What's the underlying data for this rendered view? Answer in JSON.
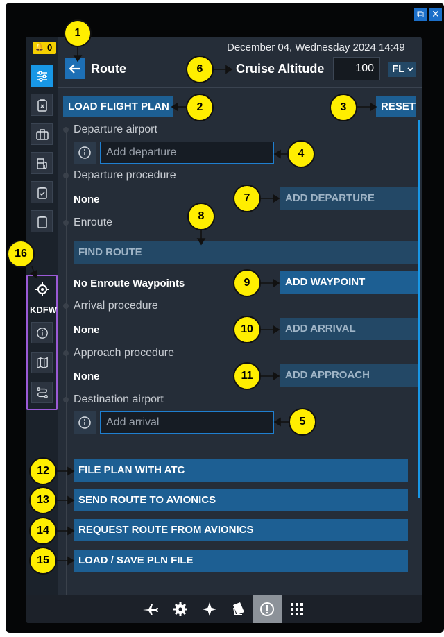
{
  "header": {
    "datetime": "December 04, Wednesday 2024 14:49",
    "back_label": "Route",
    "cruise_label": "Cruise Altitude",
    "cruise_value": "100",
    "unit_label": "FL"
  },
  "notifications": {
    "count": "0"
  },
  "window_controls": [
    "external-icon",
    "close-icon"
  ],
  "toolbar": {
    "load_flight_plan": "LOAD FLIGHT PLAN",
    "reset": "RESET"
  },
  "route": {
    "departure_airport_label": "Departure airport",
    "departure_placeholder": "Add departure",
    "departure_procedure_label": "Departure procedure",
    "departure_procedure_value": "None",
    "add_departure": "ADD DEPARTURE",
    "enroute_label": "Enroute",
    "find_route": "FIND ROUTE",
    "enroute_value": "No Enroute Waypoints",
    "add_waypoint": "ADD WAYPOINT",
    "arrival_procedure_label": "Arrival procedure",
    "arrival_procedure_value": "None",
    "add_arrival": "ADD ARRIVAL",
    "approach_procedure_label": "Approach procedure",
    "approach_procedure_value": "None",
    "add_approach": "ADD APPROACH",
    "destination_airport_label": "Destination airport",
    "arrival_placeholder": "Add arrival"
  },
  "actions": {
    "file_plan": "FILE PLAN WITH ATC",
    "send_route": "SEND ROUTE TO AVIONICS",
    "request_route": "REQUEST ROUTE FROM AVIONICS",
    "load_save": "LOAD / SAVE PLN FILE"
  },
  "sidebar": {
    "items": [
      "route-icon",
      "checklist-x-icon",
      "luggage-icon",
      "fuel-icon",
      "clipboard-check-icon",
      "clipboard-icon"
    ],
    "airport_group": {
      "code": "KDFW",
      "items": [
        "target-icon",
        "info-icon",
        "map-icon",
        "route-icon"
      ]
    }
  },
  "footer": {
    "items": [
      "airplane-icon",
      "gear-icon",
      "star-icon",
      "book-icon",
      "compass-icon",
      "grid-icon"
    ]
  },
  "callouts": [
    "1",
    "2",
    "3",
    "4",
    "5",
    "6",
    "7",
    "8",
    "9",
    "10",
    "11",
    "12",
    "13",
    "14",
    "15",
    "16"
  ],
  "colors": {
    "accent": "#1897e6",
    "button": "#1d5f93",
    "button_dim": "#234866",
    "highlight": "#ffee00",
    "group_border": "#9b5ad6"
  }
}
